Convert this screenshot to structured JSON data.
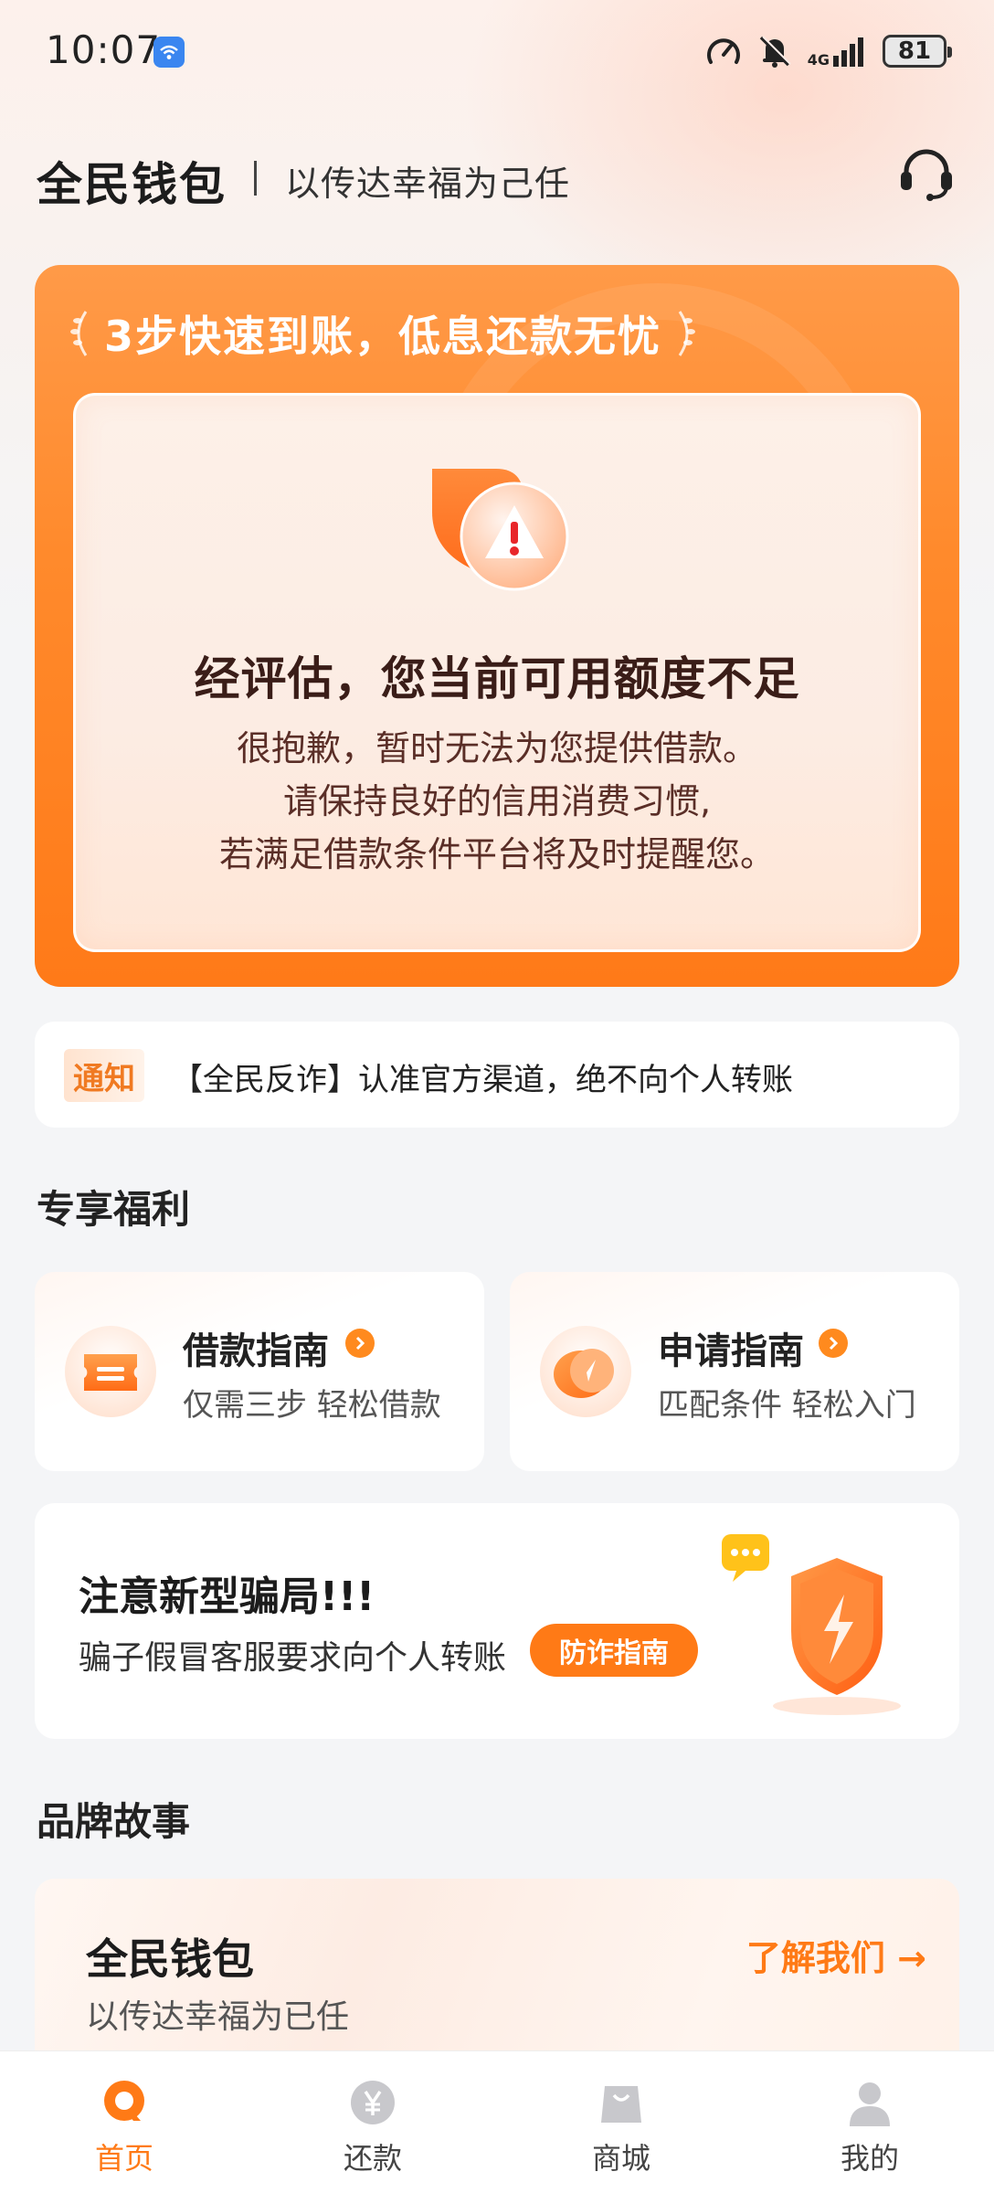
{
  "status_bar": {
    "time": "10:07",
    "network": "4G",
    "battery": "81"
  },
  "header": {
    "brand": "全民钱包",
    "slogan": "以传达幸福为己任",
    "service_icon": "headset-icon"
  },
  "hero": {
    "title": "3步快速到账，低息还款无忧",
    "headline": "经评估，您当前可用额度不足",
    "messages": [
      "很抱歉，暂时无法为您提供借款。",
      "请保持良好的信用消费习惯,",
      "若满足借款条件平台将及时提醒您。"
    ]
  },
  "notice": {
    "tag": "通知",
    "text": "【全民反诈】认准官方渠道，绝不向个人转账"
  },
  "benefits": {
    "section_title": "专享福利",
    "items": [
      {
        "title": "借款指南",
        "subtitle": "仅需三步 轻松借款",
        "icon": "ticket-icon"
      },
      {
        "title": "申请指南",
        "subtitle": "匹配条件 轻松入门",
        "icon": "compass-icon"
      }
    ]
  },
  "fraud_alert": {
    "title": "注意新型骗局!!!",
    "subtitle": "骗子假冒客服要求向个人转账",
    "button": "防诈指南",
    "icon": "shield-icon"
  },
  "brand_story": {
    "section_title": "品牌故事",
    "title": "全民钱包",
    "subtitle": "以传达幸福为已任",
    "link": "了解我们 →"
  },
  "tabbar": {
    "active_index": 0,
    "items": [
      {
        "label": "首页",
        "icon": "home-icon"
      },
      {
        "label": "还款",
        "icon": "yen-icon"
      },
      {
        "label": "商城",
        "icon": "bag-icon"
      },
      {
        "label": "我的",
        "icon": "user-icon"
      }
    ]
  },
  "colors": {
    "accent": "#ff7a16",
    "hero_gradient_top": "#ff9a48",
    "text_dark": "#222222"
  }
}
